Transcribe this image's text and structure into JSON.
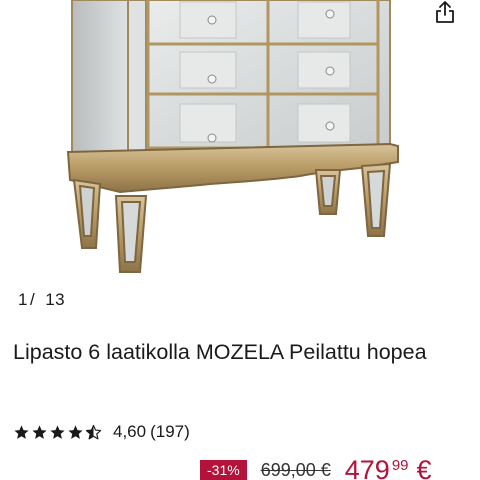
{
  "gallery": {
    "current": "1",
    "separator": "/",
    "total": "13",
    "image_alt": "mirrored chest of drawers with antique gold trim"
  },
  "actions": {
    "share_icon": "share-icon"
  },
  "product": {
    "title": "Lipasto 6 laatikolla MOZELA Peilattu hopea"
  },
  "rating": {
    "value": "4,60",
    "count": "(197)",
    "stars_filled": 4.5,
    "stars_max": 5
  },
  "price": {
    "discount": "-31%",
    "old_price": "699,00 €",
    "current_main": "479",
    "current_cents": "99",
    "currency": "€"
  },
  "colors": {
    "price_accent": "#b3123a",
    "text": "#1a1a1a",
    "star": "#1a1a1a"
  }
}
